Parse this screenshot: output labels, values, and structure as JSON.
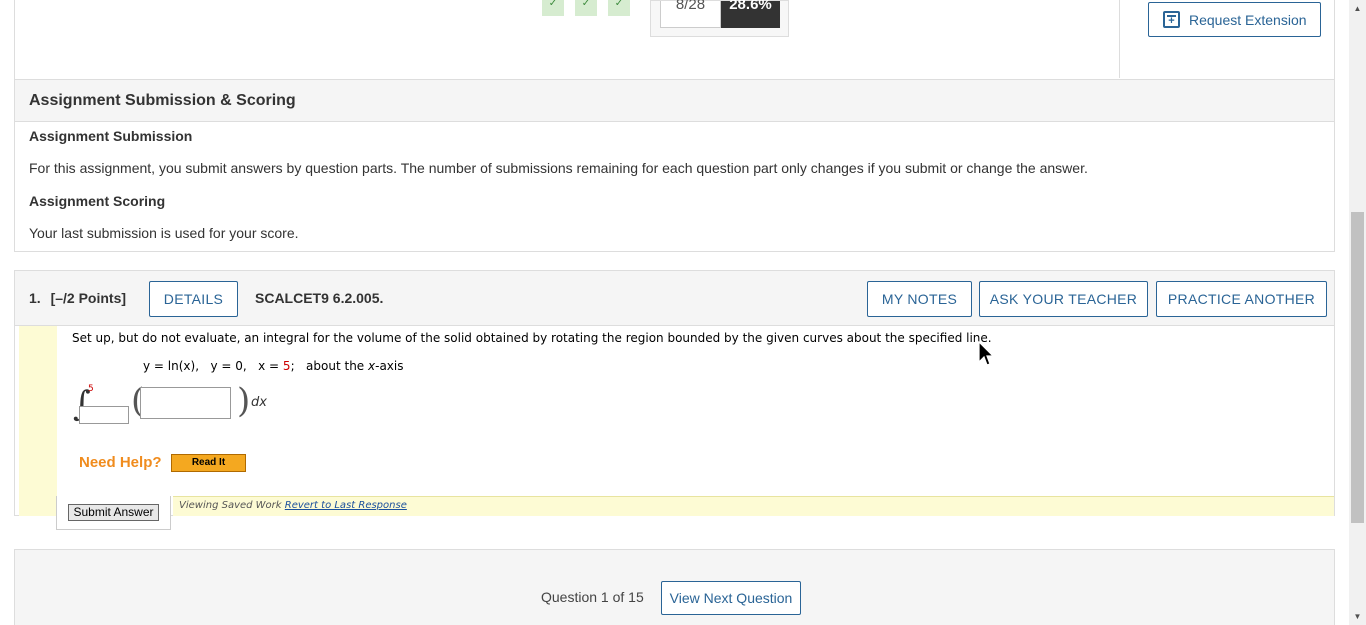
{
  "progress": {
    "checks": [
      "✓",
      "✓",
      "✓"
    ],
    "score_fraction": "8/28",
    "score_percent": "28.6%"
  },
  "top_actions": {
    "request_extension_label": "Request Extension"
  },
  "submission_scoring": {
    "header": "Assignment Submission & Scoring",
    "submission_title": "Assignment Submission",
    "submission_text": "For this assignment, you submit answers by question parts. The number of submissions remaining for each question part only changes if you submit or change the answer.",
    "scoring_title": "Assignment Scoring",
    "scoring_text": "Your last submission is used for your score."
  },
  "question": {
    "number": "1.",
    "points": "[–/2 Points]",
    "details_label": "DETAILS",
    "code": "SCALCET9 6.2.005.",
    "my_notes_label": "MY NOTES",
    "ask_teacher_label": "ASK YOUR TEACHER",
    "practice_another_label": "PRACTICE ANOTHER",
    "prompt": "Set up, but do not evaluate, an integral for the volume of the solid obtained by rotating the region bounded by the given curves about the specified line.",
    "eq_part1": "y = ln(x),   y = 0,   x = ",
    "eq_value": "5",
    "eq_part2": ";   about the ",
    "eq_axis_var": "x",
    "eq_part3": "-axis",
    "upper_limit": "5",
    "lower_limit_value": "",
    "integrand_value": "",
    "dx_label": "dx",
    "need_help_label": "Need Help?",
    "read_it_label": "Read It",
    "saved_work_text": "Viewing Saved Work ",
    "revert_link_label": "Revert to Last Response",
    "submit_label": "Submit Answer"
  },
  "navigation": {
    "question_count": "Question 1 of 15",
    "next_label": "View Next Question"
  },
  "colors": {
    "accent": "#2a6496",
    "help_orange": "#f08c1e",
    "highlight_yellow": "#fdfbd4",
    "score_dark": "#333333"
  }
}
